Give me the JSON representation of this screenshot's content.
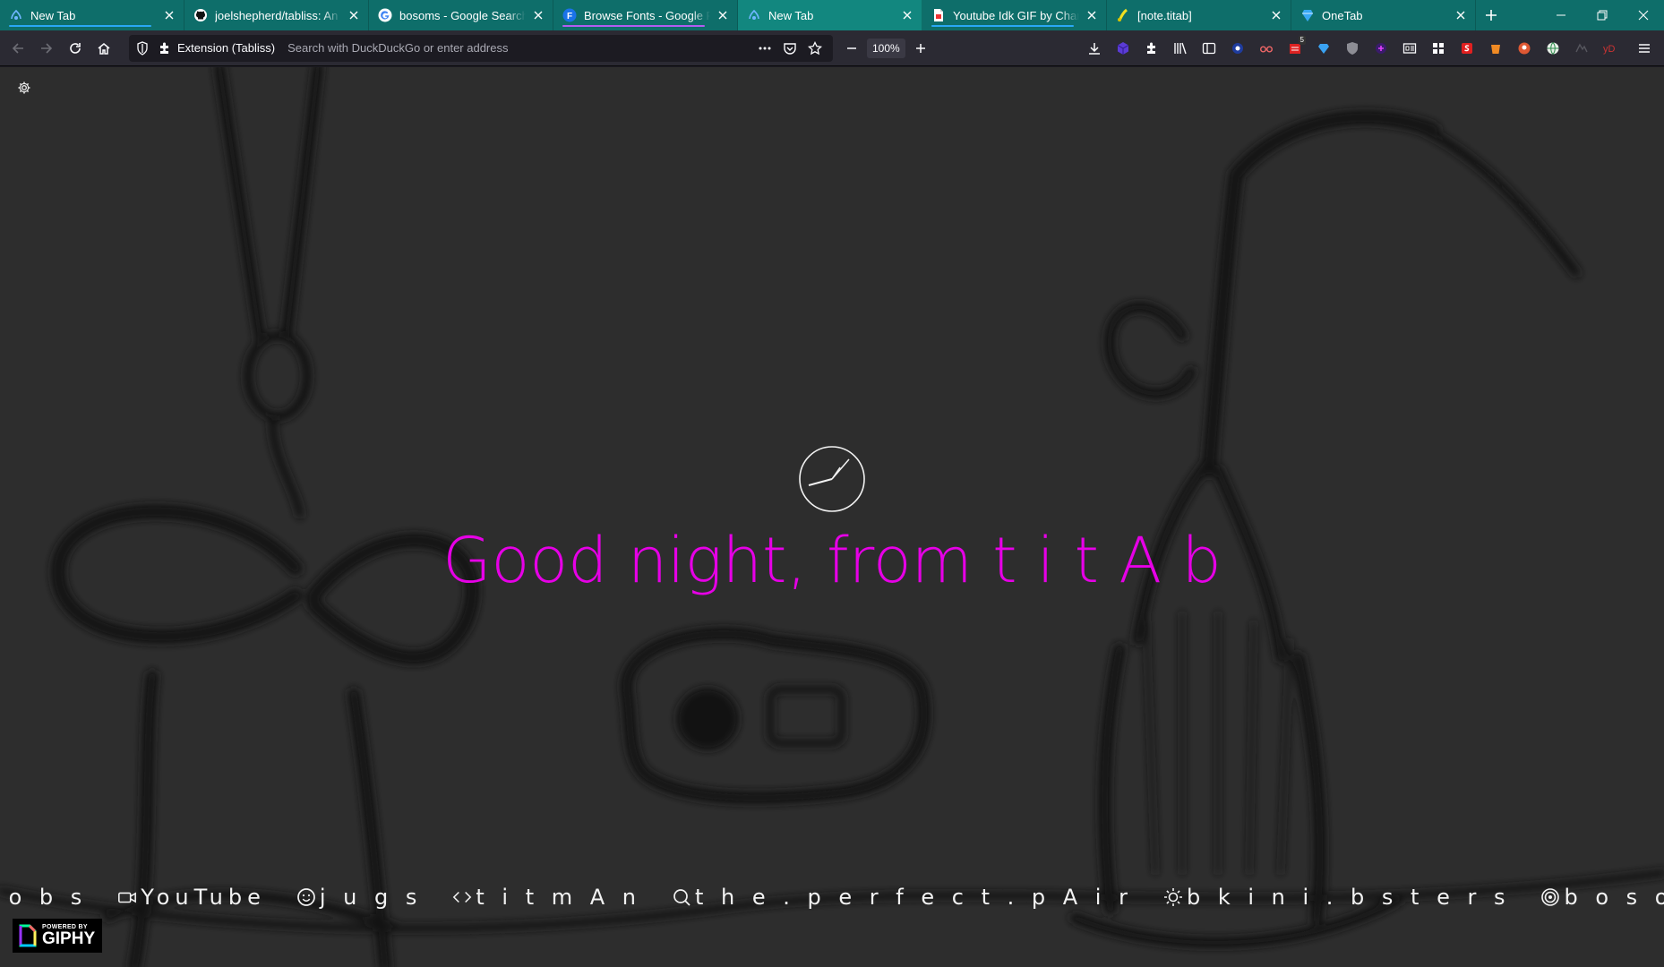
{
  "tabs": [
    {
      "title": "New Tab",
      "icon": "tabliss-icon",
      "underline": "#29a8f5",
      "selected": false
    },
    {
      "title": "joelshepherd/tabliss: An extension",
      "icon": "github-icon",
      "underline": "",
      "selected": false
    },
    {
      "title": "bosoms - Google Search",
      "icon": "google-icon",
      "underline": "",
      "selected": false
    },
    {
      "title": "Browse Fonts - Google Fonts",
      "icon": "google-fonts-icon",
      "underline": "#b25cf1",
      "selected": false
    },
    {
      "title": "New Tab",
      "icon": "tabliss-icon",
      "underline": "",
      "selected": true
    },
    {
      "title": "Youtube Idk GIF by Channel",
      "icon": "document-icon",
      "underline": "#29a8f5",
      "selected": false
    },
    {
      "title": "[note.titab]",
      "icon": "note-icon",
      "underline": "",
      "selected": false
    },
    {
      "title": "OneTab",
      "icon": "onetab-icon",
      "underline": "",
      "selected": false
    }
  ],
  "urlbar": {
    "identity": "Extension (Tabliss)",
    "placeholder": "Search with DuckDuckGo or enter address"
  },
  "zoom": {
    "value": "100%"
  },
  "toolbar": {
    "badge_count": "5"
  },
  "greeting": "Good night, from t i t A b",
  "links": [
    {
      "icon": "smiley-icon",
      "label": "b o o b s"
    },
    {
      "icon": "video-icon",
      "label": "YouTube"
    },
    {
      "icon": "smiley-icon",
      "label": "j u g s"
    },
    {
      "icon": "code-icon",
      "label": "t i t m A n"
    },
    {
      "icon": "search-icon",
      "label": "t h e . p e r f e c t . p A i r"
    },
    {
      "icon": "sun-icon",
      "label": "b k i n i . b s t e r s"
    },
    {
      "icon": "target-icon",
      "label": "b o s o m s"
    }
  ],
  "giphy": {
    "powered_by": "POWERED BY",
    "brand": "GIPHY"
  },
  "colors": {
    "tabstrip": "#0e6e6a",
    "greeting": "#e600e6",
    "background": "#353535"
  }
}
